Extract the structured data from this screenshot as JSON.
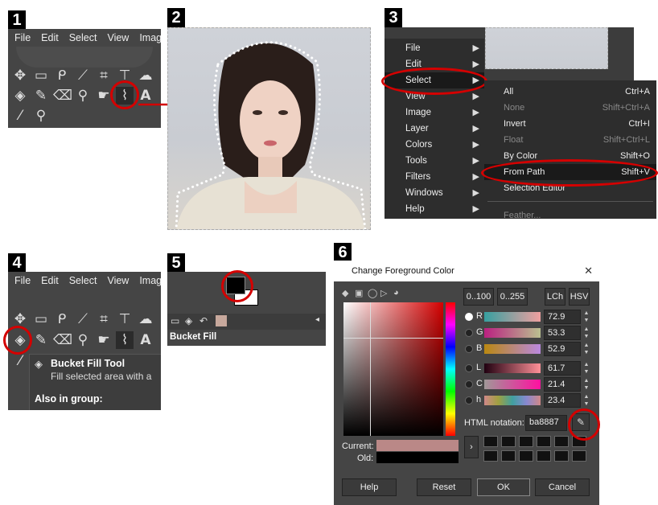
{
  "steps": [
    "1",
    "2",
    "3",
    "4",
    "5",
    "6"
  ],
  "menubar": [
    "File",
    "Edit",
    "Select",
    "View",
    "Image"
  ],
  "step3_menu": {
    "items": [
      "File",
      "Edit",
      "Select",
      "View",
      "Image",
      "Layer",
      "Colors",
      "Tools",
      "Filters",
      "Windows",
      "Help"
    ],
    "submenu": [
      {
        "label": "All",
        "shortcut": "Ctrl+A"
      },
      {
        "label": "None",
        "shortcut": "Shift+Ctrl+A"
      },
      {
        "label": "Invert",
        "shortcut": "Ctrl+I"
      },
      {
        "label": "Float",
        "shortcut": "Shift+Ctrl+L"
      },
      {
        "label": "By Color",
        "shortcut": "Shift+O"
      },
      {
        "label": "From Path",
        "shortcut": "Shift+V"
      },
      {
        "label": "Selection Editor",
        "shortcut": ""
      },
      {
        "label": "Feather...",
        "shortcut": ""
      }
    ]
  },
  "step4_tooltip": {
    "title": "Bucket Fill Tool",
    "desc": "Fill selected area with a",
    "group": "Also in group:"
  },
  "step5": {
    "tab_label": "Bucket Fill"
  },
  "dialog": {
    "title": "Change Foreground Color",
    "close": "✕",
    "range_buttons": [
      "0..100",
      "0..255"
    ],
    "mode_buttons": [
      "LCh",
      "HSV"
    ],
    "channels": [
      {
        "label": "R",
        "value": "72.9",
        "selected": true
      },
      {
        "label": "G",
        "value": "53.3",
        "selected": false
      },
      {
        "label": "B",
        "value": "52.9",
        "selected": false
      },
      {
        "label": "L",
        "value": "61.7",
        "selected": false
      },
      {
        "label": "C",
        "value": "21.4",
        "selected": false
      },
      {
        "label": "h",
        "value": "23.4",
        "selected": false
      }
    ],
    "html_label": "HTML notation:",
    "html_value": "ba8887",
    "current_label": "Current:",
    "old_label": "Old:",
    "current_color": "#ba8887",
    "old_color": "#000000",
    "buttons": [
      "Help",
      "Reset",
      "OK",
      "Cancel"
    ]
  },
  "colors": {
    "accent": "#d40000",
    "panel": "#454545",
    "menu_bg": "#2d2d2d"
  }
}
